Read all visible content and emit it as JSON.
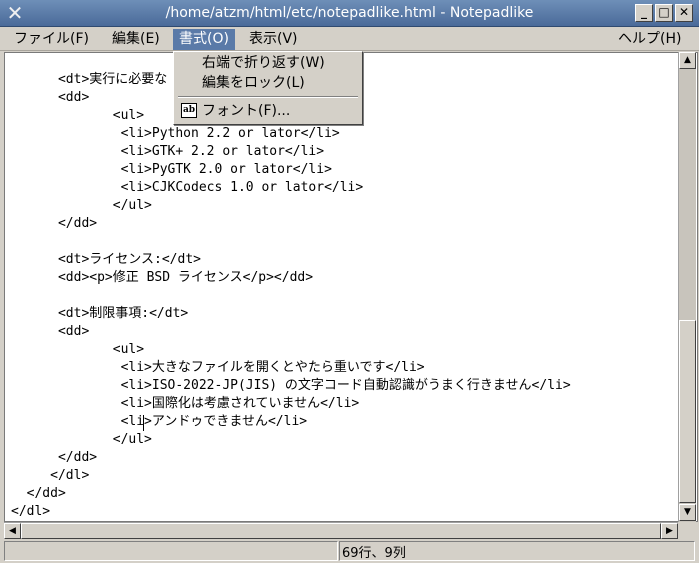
{
  "window": {
    "title": "/home/atzm/html/etc/notepadlike.html - Notepadlike",
    "app_icon_glyph": "✕",
    "minimize_glyph": "_",
    "maximize_glyph": "□",
    "close_glyph": "✕"
  },
  "menubar": {
    "file": "ファイル(F)",
    "edit": "編集(E)",
    "format": "書式(O)",
    "view": "表示(V)",
    "help": "ヘルプ(H)"
  },
  "format_menu": {
    "wrap": "右端で折り返す(W)",
    "lock": "編集をロック(L)",
    "font": "フォント(F)...",
    "font_icon_text": "ab"
  },
  "editor": {
    "lines": [
      "",
      "      <dt>実行に必要な",
      "      <dd>",
      "             <ul>",
      "              <li>Python 2.2 or lator</li>",
      "              <li>GTK+ 2.2 or lator</li>",
      "              <li>PyGTK 2.0 or lator</li>",
      "              <li>CJKCodecs 1.0 or lator</li>",
      "             </ul>",
      "      </dd>",
      "",
      "      <dt>ライセンス:</dt>",
      "      <dd><p>修正 BSD ライセンス</p></dd>",
      "",
      "      <dt>制限事項:</dt>",
      "      <dd>",
      "             <ul>",
      "              <li>大きなファイルを開くとやたら重いです</li>",
      "              <li>ISO-2022-JP(JIS) の文字コード自動認識がうまく行きません</li>",
      "              <li>国際化は考慮されていません</li>",
      "              <li>アンドゥできません</li>",
      "             </ul>",
      "      </dd>",
      "     </dl>",
      "  </dd>",
      "</dl>"
    ]
  },
  "scrollbar": {
    "up_glyph": "▲",
    "down_glyph": "▼",
    "left_glyph": "◀",
    "right_glyph": "▶",
    "vertical_position": 0.57,
    "horizontal_position": 0.0
  },
  "status": {
    "position": "69行、9列"
  }
}
